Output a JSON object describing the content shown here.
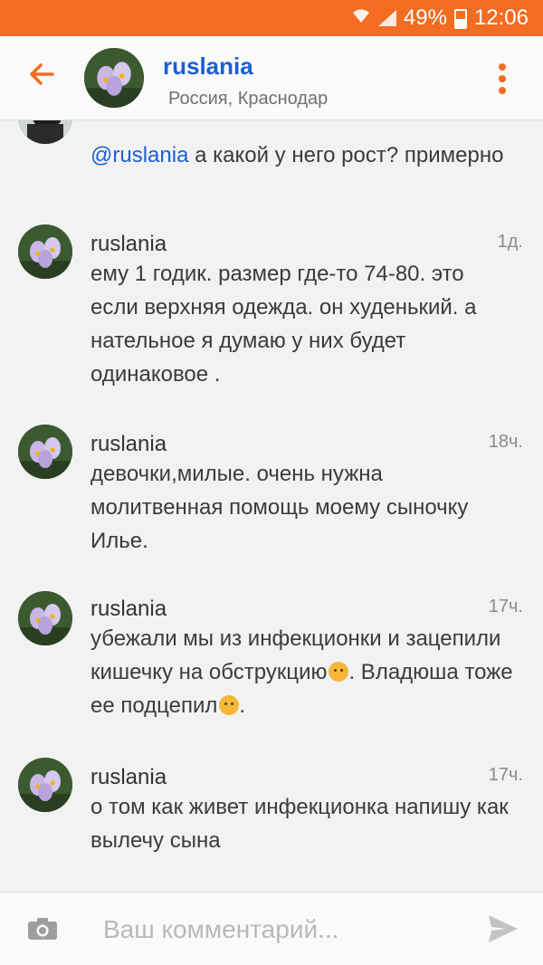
{
  "status_bar": {
    "battery": "49%",
    "time": "12:06",
    "wifi_icon": "wifi-icon",
    "signal_icon": "signal-icon",
    "battery_icon": "battery-icon"
  },
  "header": {
    "back_icon": "arrow-left-icon",
    "name": "ruslania",
    "location": "Россия, Краснодар",
    "menu_icon": "more-vertical-icon",
    "accent_color": "#f36c21",
    "link_color": "#1b5fd3"
  },
  "messages": [
    {
      "mention": "@ruslania",
      "text": " а какой у него рост? примерно"
    },
    {
      "author": "ruslania",
      "time": "1д.",
      "text": "ему 1 годик. размер где-то 74-80.  это если верхняя одежда. он худенький. а нательное я думаю у них будет одинаковое ."
    },
    {
      "author": "ruslania",
      "time": "18ч.",
      "text": "девочки,милые.  очень нужна молитвенная помощь моему сыночку Илье."
    },
    {
      "author": "ruslania",
      "time": "17ч.",
      "text_part1": "убежали мы из инфекционки и зацепили кишечку на обструкцию",
      "emoji1": "persevering-face-emoji",
      "text_part2": ". Владюша тоже ее подцепил",
      "emoji2": "kissing-face-emoji",
      "text_part3": "."
    },
    {
      "author": "ruslania",
      "time": "17ч.",
      "text": "о том как живет инфекционка напишу как вылечу сына"
    }
  ],
  "composer": {
    "camera_icon": "camera-icon",
    "placeholder": "Ваш комментарий...",
    "value": "",
    "send_icon": "send-icon"
  }
}
